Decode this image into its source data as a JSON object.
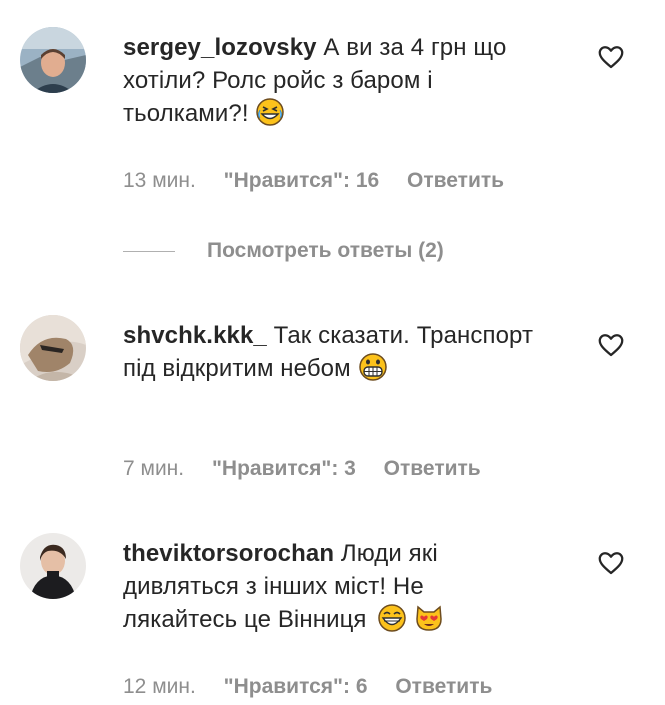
{
  "comments": [
    {
      "username": "sergey_lozovsky",
      "text": "А ви за 4 грн що хотіли? Ролс ройс з баром і тьолками?!",
      "emojis": [
        "laughing-tears-emoji"
      ],
      "time": "13 мин.",
      "likes": "\"Нравится\": 16",
      "reply": "Ответить"
    },
    {
      "username": "shvchk.kkk_",
      "text": "Так сказати. Транспорт під відкритим небом",
      "emojis": [
        "grimacing-emoji"
      ],
      "time": "7 мин.",
      "likes": "\"Нравится\": 3",
      "reply": "Ответить"
    },
    {
      "username": "theviktorsorochan",
      "text": "Люди які дивляться з інших міст! Не лякайтесь це Вінниця",
      "emojis": [
        "grinning-emoji",
        "heart-eyes-cat-emoji"
      ],
      "time": "12 мин.",
      "likes": "\"Нравится\": 6",
      "reply": "Ответить"
    }
  ],
  "view_replies": "Посмотреть ответы (2)",
  "colors": {
    "text": "#262626",
    "muted": "#8e8e8e",
    "emoji_yellow": "#fcc21b"
  }
}
